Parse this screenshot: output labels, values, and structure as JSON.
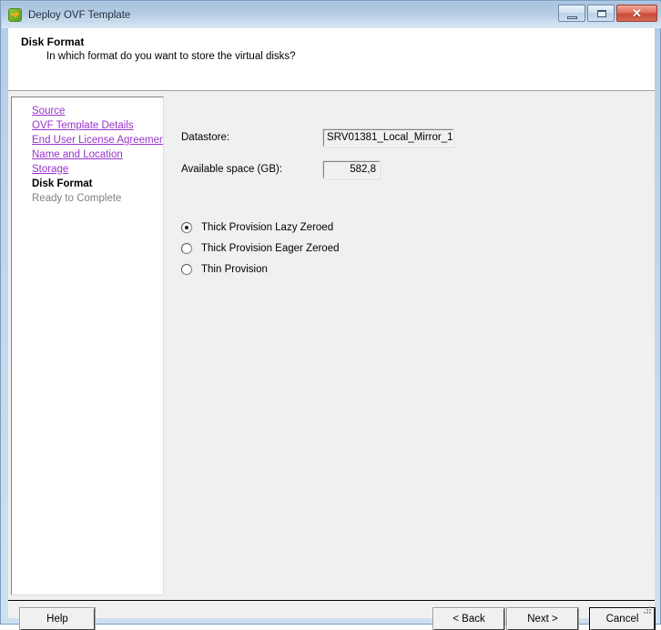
{
  "window": {
    "title": "Deploy OVF Template",
    "icon": "ovf-deploy-icon",
    "controls": {
      "minimize": "minimize-icon",
      "maximize": "maximize-icon",
      "close": "✕"
    }
  },
  "header": {
    "title": "Disk Format",
    "subtitle": "In which format do you want to store the virtual disks?"
  },
  "sidebar": {
    "items": [
      {
        "label": "Source",
        "state": "link"
      },
      {
        "label": "OVF Template Details",
        "state": "link"
      },
      {
        "label": "End User License Agreement",
        "state": "link"
      },
      {
        "label": "Name and Location",
        "state": "link"
      },
      {
        "label": "Storage",
        "state": "link"
      },
      {
        "label": "Disk Format",
        "state": "current"
      },
      {
        "label": "Ready to Complete",
        "state": "pending"
      }
    ],
    "link_color": "#9933cc",
    "current_color": "#000000",
    "pending_color": "#808080"
  },
  "form": {
    "datastore_label": "Datastore:",
    "datastore_value": "SRV01381_Local_Mirror_1",
    "available_space_label": "Available space (GB):",
    "available_space_value": "582,8",
    "provisioning": {
      "selected_index": 0,
      "options": [
        "Thick Provision Lazy Zeroed",
        "Thick Provision Eager Zeroed",
        "Thin Provision"
      ]
    }
  },
  "buttons": {
    "help": "Help",
    "back": "< Back",
    "next": "Next >",
    "cancel": "Cancel"
  },
  "colors": {
    "titlebar_top": "#a9c2dd",
    "titlebar_bottom": "#dbe8f4",
    "frame": "#b3cce6",
    "content_bg": "#f0f0f0",
    "panel_bg": "#ffffff",
    "close_button": "#c84a33"
  }
}
